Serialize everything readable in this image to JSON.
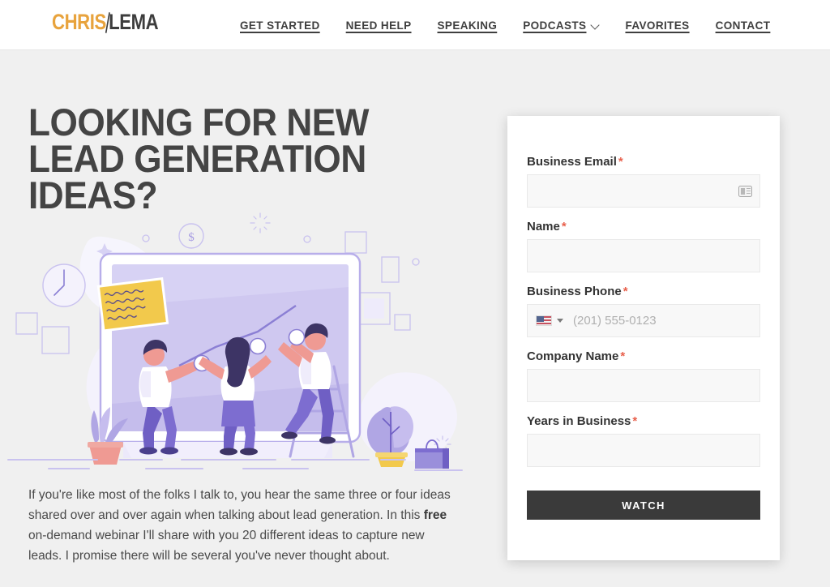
{
  "header": {
    "logo": {
      "part1": "CHRIS",
      "part2": "LEMA"
    },
    "nav": [
      {
        "label": "GET STARTED",
        "has_chevron": false
      },
      {
        "label": "NEED HELP",
        "has_chevron": false
      },
      {
        "label": "SPEAKING",
        "has_chevron": false
      },
      {
        "label": "PODCASTS",
        "has_chevron": true
      },
      {
        "label": "FAVORITES",
        "has_chevron": false
      },
      {
        "label": "CONTACT",
        "has_chevron": false
      }
    ]
  },
  "hero": {
    "headline": "LOOKING FOR NEW LEAD GENERATION IDEAS?",
    "paragraph_part1": "If you're like most of the folks I talk to, you hear the same three or four ideas shared over and over again when talking about lead generation. In this ",
    "paragraph_bold": "free",
    "paragraph_part2": " on-demand webinar I'll share with you 20 different ideas to capture new leads. I promise there will be several you've never thought about."
  },
  "form": {
    "fields": [
      {
        "label": "Business Email",
        "required": "*",
        "value": "",
        "placeholder": ""
      },
      {
        "label": "Name",
        "required": "*",
        "value": "",
        "placeholder": ""
      },
      {
        "label": "Business Phone",
        "required": "*",
        "value": "",
        "placeholder": "(201) 555-0123",
        "country": "US"
      },
      {
        "label": "Company Name",
        "required": "*",
        "value": "",
        "placeholder": ""
      },
      {
        "label": "Years in Business",
        "required": "*",
        "value": "",
        "placeholder": ""
      }
    ],
    "submit_label": "WATCH"
  },
  "colors": {
    "page_background": "#f0f0f0",
    "logo_accent": "#e8a33d",
    "logo_dark": "#3d3d3d",
    "headline": "#444444",
    "required_asterisk": "#e8604c",
    "button_background": "#3a3a3a",
    "illustration_purple": "#8b7fd4",
    "illustration_light_purple": "#d7d2f4",
    "illustration_pink": "#ef9a93",
    "illustration_yellow": "#f2c94c"
  },
  "illustration": {
    "alt": "Three people assembling a line chart on a large monitor screen",
    "elements": [
      "monitor",
      "line-chart",
      "ladder",
      "sticky-note",
      "clock",
      "dollar-coin",
      "potted-plant",
      "tree",
      "briefcase",
      "sparkle",
      "squares"
    ]
  }
}
